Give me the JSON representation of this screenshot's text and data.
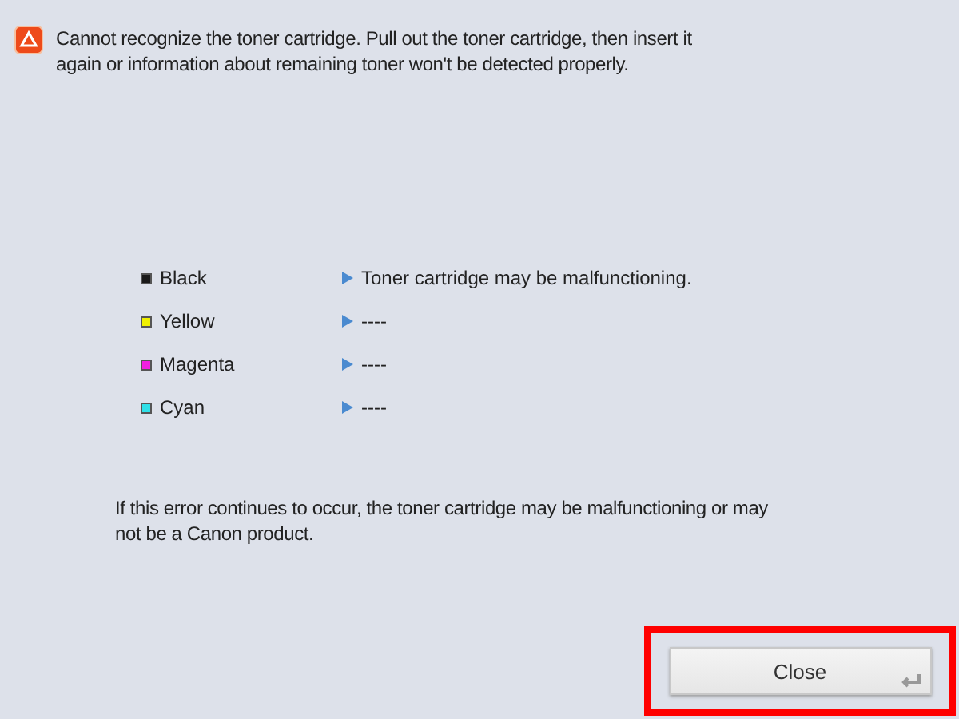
{
  "message": "Cannot recognize the toner cartridge. Pull out the toner cartridge, then insert it again or information about remaining toner won't be detected properly.",
  "toners": [
    {
      "name": "Black",
      "color": "#1a1a1a",
      "status": "Toner cartridge may be malfunctioning."
    },
    {
      "name": "Yellow",
      "color": "#f0f000",
      "status": "----"
    },
    {
      "name": "Magenta",
      "color": "#f020e0",
      "status": "----"
    },
    {
      "name": "Cyan",
      "color": "#30e0e8",
      "status": "----"
    }
  ],
  "note": "If this error continues to occur, the toner cartridge may be malfunctioning or may not be a Canon product.",
  "close_button": {
    "label": "Close",
    "highlighted": true
  }
}
